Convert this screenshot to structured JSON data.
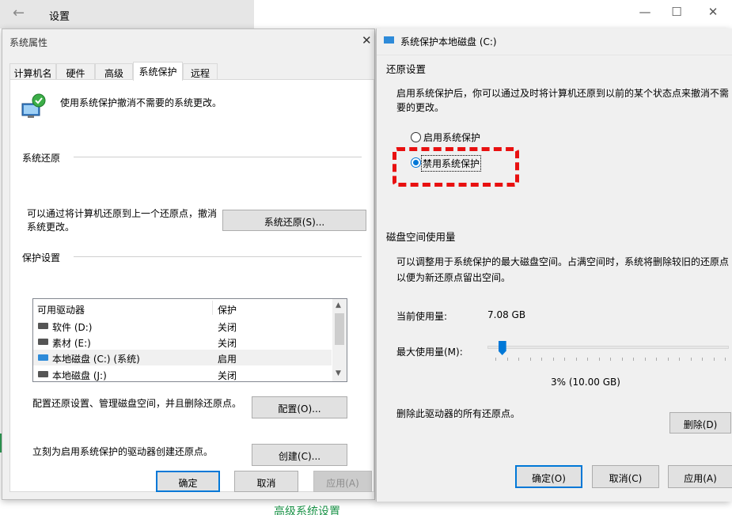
{
  "settings": {
    "title": "设置",
    "back_icon": "back-arrow-icon",
    "controls": {
      "minimize": "—",
      "maximize": "☐",
      "close": "✕"
    },
    "advanced_link": "高级系统设置"
  },
  "sys_props": {
    "title": "系统属性",
    "close": "✕",
    "tabs": [
      "计算机名",
      "硬件",
      "高级",
      "系统保护",
      "远程"
    ],
    "active_tab": "系统保护",
    "description": "使用系统保护撤消不需要的系统更改。",
    "restore_group": "系统还原",
    "restore_text": "可以通过将计算机还原到上一个还原点，撤消系统更改。",
    "restore_button": "系统还原(S)...",
    "protection_group": "保护设置",
    "columns": [
      "可用驱动器",
      "保护"
    ],
    "drives": [
      {
        "name": "软件 (D:)",
        "state": "关闭",
        "icon": "drive-icon"
      },
      {
        "name": "素材 (E:)",
        "state": "关闭",
        "icon": "drive-icon"
      },
      {
        "name": "本地磁盘 (C:) (系统)",
        "state": "启用",
        "icon": "system-drive-icon"
      },
      {
        "name": "本地磁盘 (J:)",
        "state": "关闭",
        "icon": "drive-icon"
      }
    ],
    "config_text": "配置还原设置、管理磁盘空间，并且删除还原点。",
    "config_button": "配置(O)...",
    "create_text": "立刻为启用系统保护的驱动器创建还原点。",
    "create_button": "创建(C)...",
    "ok": "确定",
    "cancel": "取消",
    "apply": "应用(A)"
  },
  "disk_dlg": {
    "title": "系统保护本地磁盘 (C:)",
    "restore_section": "还原设置",
    "restore_desc": "启用系统保护后，你可以通过及时将计算机还原到以前的某个状态点来撤消不需要的更改。",
    "radio_enable": "启用系统保护",
    "radio_disable": "禁用系统保护",
    "selected_option": "禁用系统保护",
    "disk_section": "磁盘空间使用量",
    "disk_desc": "可以调整用于系统保护的最大磁盘空间。占满空间时，系统将删除较旧的还原点以便为新还原点留出空间。",
    "current_label": "当前使用量:",
    "current_value": "7.08 GB",
    "max_label": "最大使用量(M):",
    "max_fraction": 0.03,
    "max_value": "3% (10.00 GB)",
    "delete_text": "删除此驱动器的所有还原点。",
    "delete_button": "删除(D)",
    "ok": "确定(O)",
    "cancel": "取消(C)",
    "apply": "应用(A)"
  },
  "colors": {
    "accent": "#0078d7",
    "highlight": "#e81010",
    "link": "#1b9348"
  }
}
